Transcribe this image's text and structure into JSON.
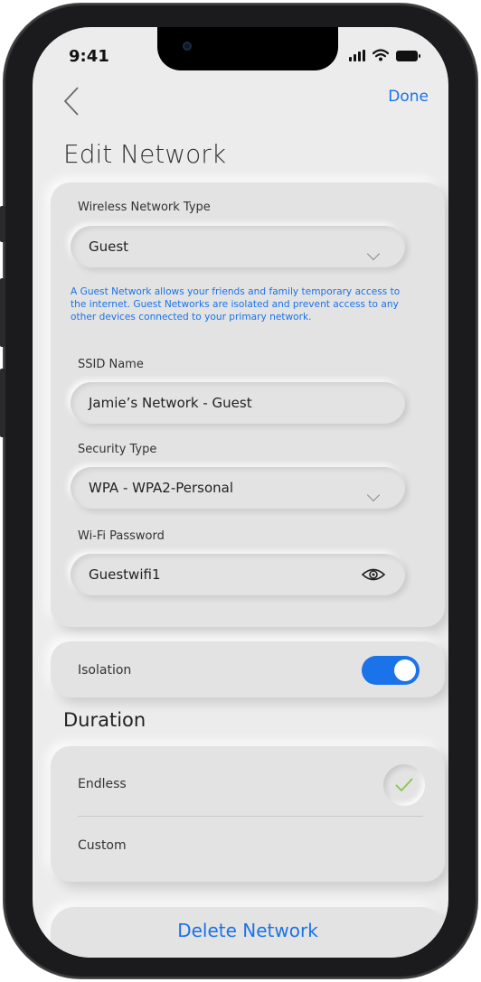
{
  "status_bar": {
    "time": "9:41"
  },
  "nav": {
    "done_label": "Done"
  },
  "page": {
    "title": "Edit Network"
  },
  "network": {
    "type_label": "Wireless Network Type",
    "type_value": "Guest",
    "info": "A Guest Network allows your friends and family temporary access to the internet. Guest Networks are isolated and prevent access to any other devices connected to your primary network.",
    "ssid_label": "SSID Name",
    "ssid_value": "Jamie’s Network - Guest",
    "security_label": "Security Type",
    "security_value": "WPA - WPA2-Personal",
    "password_label": "Wi-Fi Password",
    "password_value": "Guestwifi1"
  },
  "isolation": {
    "label": "Isolation",
    "enabled": true
  },
  "duration": {
    "title": "Duration",
    "options": [
      {
        "label": "Endless",
        "selected": true
      },
      {
        "label": "Custom",
        "selected": false
      }
    ]
  },
  "delete": {
    "label": "Delete Network"
  },
  "colors": {
    "accent": "#1a73e8",
    "check": "#8bc34a",
    "background": "#ececec"
  },
  "icons": [
    "back-chevron-icon",
    "wifi-icon",
    "signal-icon",
    "battery-icon",
    "chevron-down-icon",
    "eye-icon",
    "check-icon"
  ]
}
